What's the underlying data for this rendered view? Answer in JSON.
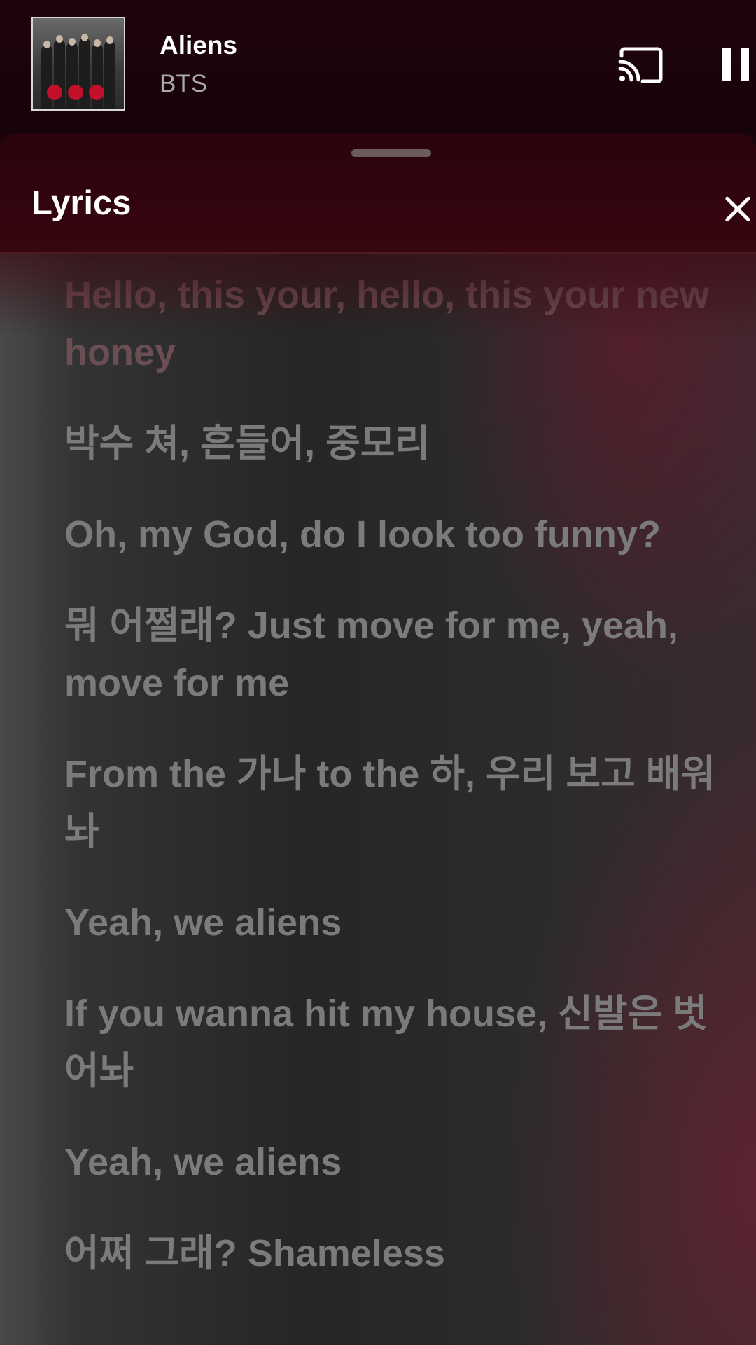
{
  "now_playing": {
    "title": "Aliens",
    "artist": "BTS"
  },
  "controls": {
    "cast_icon": "cast-icon",
    "pause_icon": "pause-icon"
  },
  "lyrics_sheet": {
    "title": "Lyrics",
    "close_icon": "close-icon",
    "lines": [
      "Hello, this your, hello, this your new honey",
      "박수 쳐, 흔들어, 중모리",
      "Oh, my God, do I look too funny?",
      "뭐 어쩔래? Just move for me, yeah, move for me",
      "From the 가나 to the 하, 우리 보고 배워놔",
      "Yeah, we aliens",
      "If you wanna hit my house, 신발은 벗어놔",
      "Yeah, we aliens",
      "어쩌 그래? Shameless"
    ]
  },
  "colors": {
    "accent": "#c2102a",
    "lyric_text": "#7b7b7b",
    "header_bg": "#2a030c"
  }
}
